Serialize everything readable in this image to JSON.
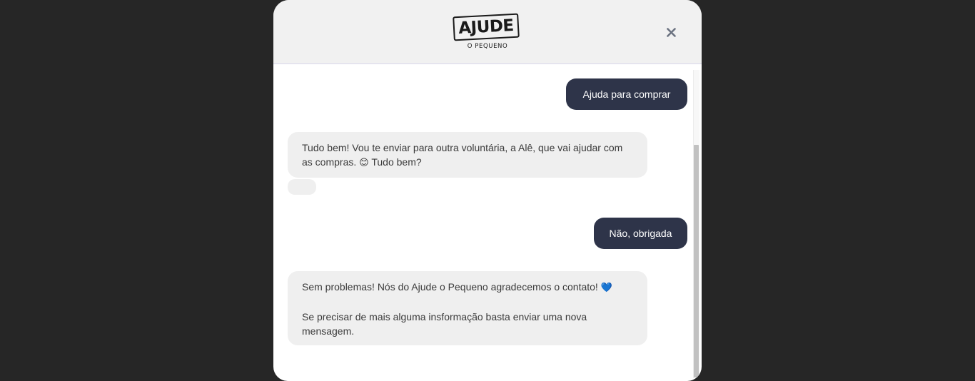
{
  "header": {
    "logo_word": "AJUDE",
    "logo_sub": "O PEQUENO",
    "close_icon": "close-icon",
    "colors": {
      "header_bg": "#f1f1f1",
      "overlay": "#262626"
    }
  },
  "messages": [
    {
      "from": "user",
      "text": "Ajuda para comprar"
    },
    {
      "from": "bot",
      "text_before_emoji": "Tudo bem! Vou te enviar para outra voluntária, a Alê, que vai ajudar com as compras. ",
      "emoji": "😊",
      "text_after_emoji": " Tudo bem?"
    },
    {
      "from": "user",
      "text": "Não, obrigada"
    },
    {
      "from": "bot",
      "line1": "Sem problemas! Nós do Ajude o Pequeno agradecemos o contato! ",
      "emoji": "💙",
      "line2": "Se precisar de mais alguma insformação basta enviar uma nova mensagem."
    }
  ],
  "colors": {
    "user_bubble": "#2e3449",
    "bot_bubble": "#efefef",
    "heart": "#3b82f6",
    "smile": "#f5c518"
  }
}
